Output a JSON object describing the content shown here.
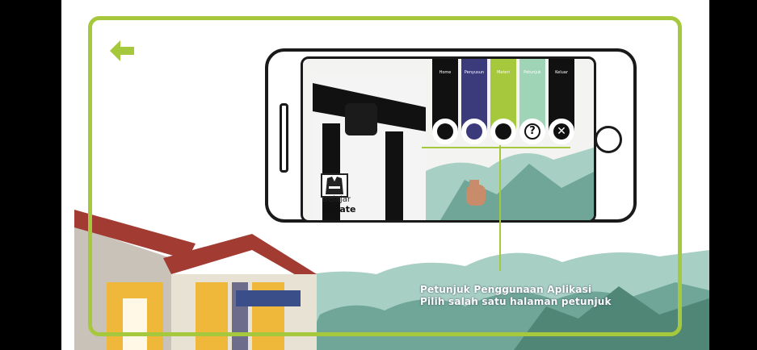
{
  "menu": {
    "items": [
      {
        "label": "Home",
        "icon": "home-icon",
        "color": "#111111",
        "icon_color": "#111111"
      },
      {
        "label": "Penyusun",
        "icon": "user-icon",
        "color": "#3b3a7a",
        "icon_color": "#3b3a7a"
      },
      {
        "label": "Materi",
        "icon": "video-icon",
        "color": "#a6c83c",
        "icon_color": "#111111"
      },
      {
        "label": "Petunjuk",
        "icon": "help-icon",
        "color": "#9fd4b6",
        "icon_color": "#111111"
      },
      {
        "label": "Keluar",
        "icon": "close-icon",
        "color": "#111111",
        "icon_color": "#111111"
      }
    ]
  },
  "logo": {
    "line1": "Belajar",
    "line2": "Karate"
  },
  "caption": {
    "line1": "Petunjuk Penggunaan Aplikasi",
    "line2": "Pilih salah satu halaman petunjuk"
  },
  "colors": {
    "accent": "#a6c83c",
    "mountain": "#7fb6a8"
  }
}
